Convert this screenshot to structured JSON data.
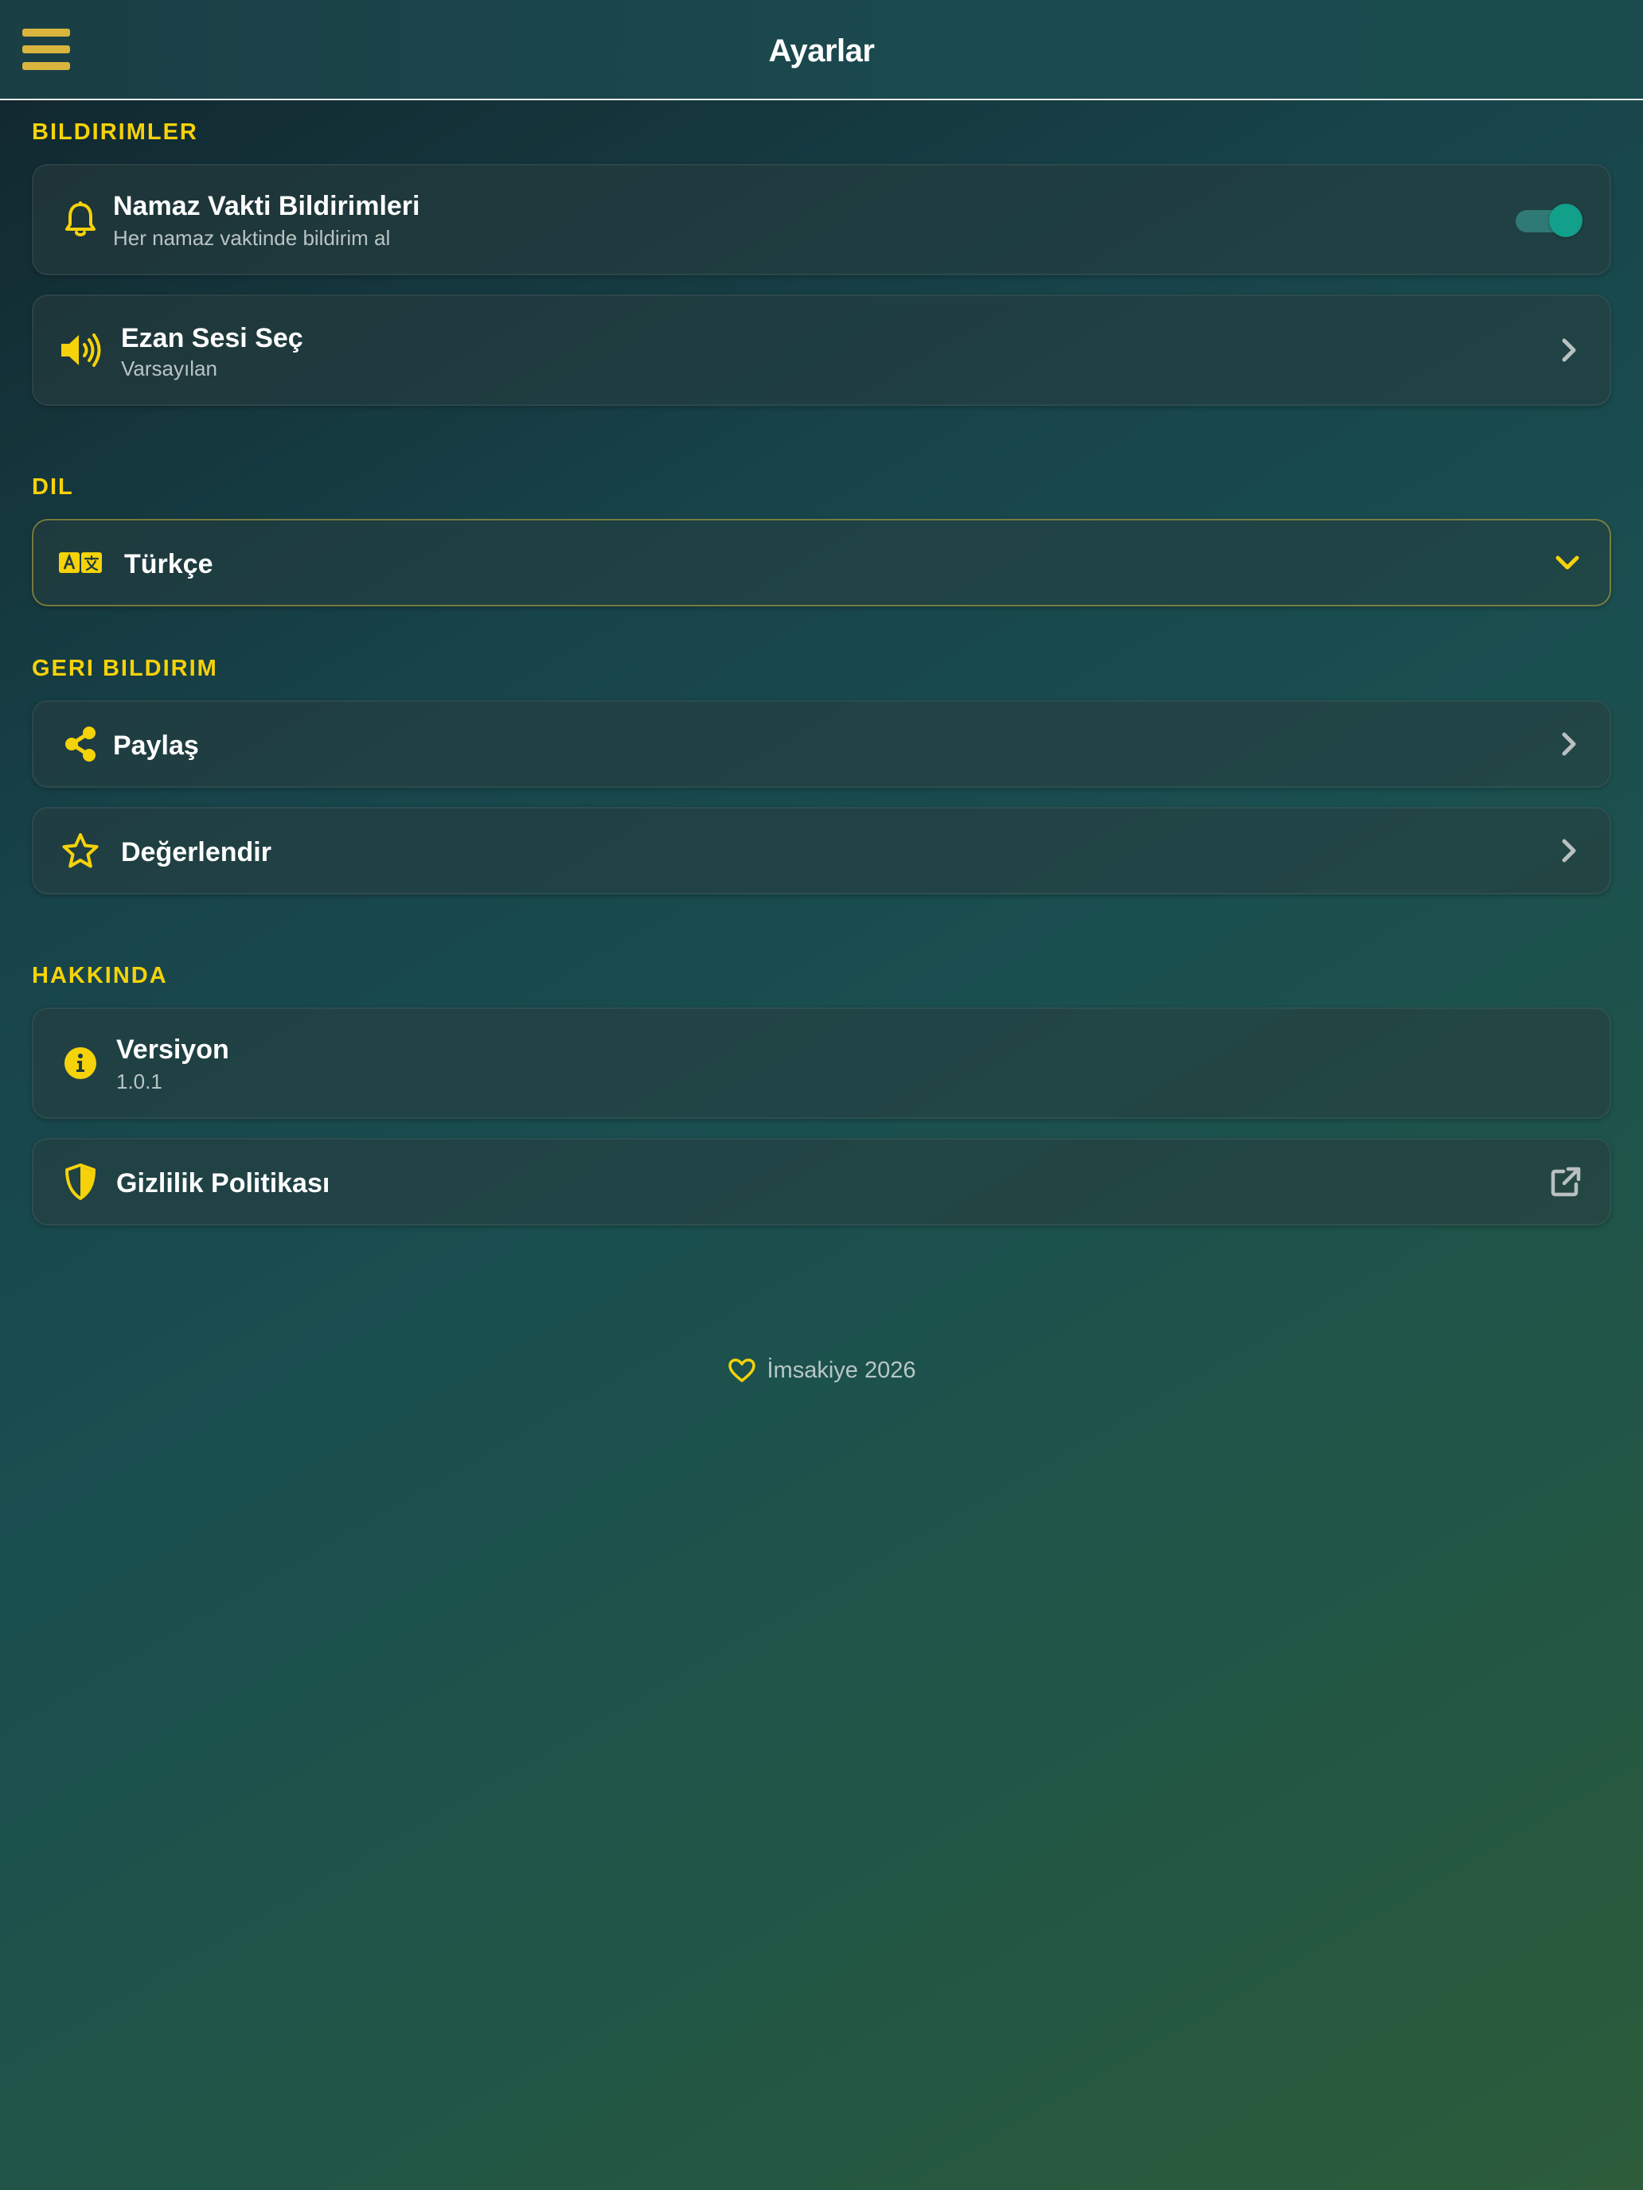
{
  "header": {
    "title": "Ayarlar",
    "menu_icon": "hamburger-menu-icon"
  },
  "sections": {
    "notifications": {
      "title": "BILDIRIMLER",
      "prayer_notifications": {
        "label": "Namaz Vakti Bildirimleri",
        "subtitle": "Her namaz vaktinde bildirim al",
        "icon": "bell-icon",
        "toggle_on": true
      },
      "adhan_sound": {
        "label": "Ezan Sesi Seç",
        "subtitle": "Varsayılan",
        "icon": "speaker-icon"
      }
    },
    "language": {
      "title": "DIL",
      "selected": "Türkçe",
      "icon": "translate-icon"
    },
    "feedback": {
      "title": "GERI BILDIRIM",
      "share": {
        "label": "Paylaş",
        "icon": "share-icon"
      },
      "rate": {
        "label": "Değerlendir",
        "icon": "star-icon"
      }
    },
    "about": {
      "title": "HAKKINDA",
      "version": {
        "label": "Versiyon",
        "value": "1.0.1",
        "icon": "info-icon"
      },
      "privacy": {
        "label": "Gizlilik Politikası",
        "icon": "shield-icon"
      }
    }
  },
  "footer": {
    "text": "İmsakiye 2026",
    "icon": "heart-icon"
  },
  "colors": {
    "accent": "#f5d20a",
    "toggle_on": "#12a08a"
  }
}
